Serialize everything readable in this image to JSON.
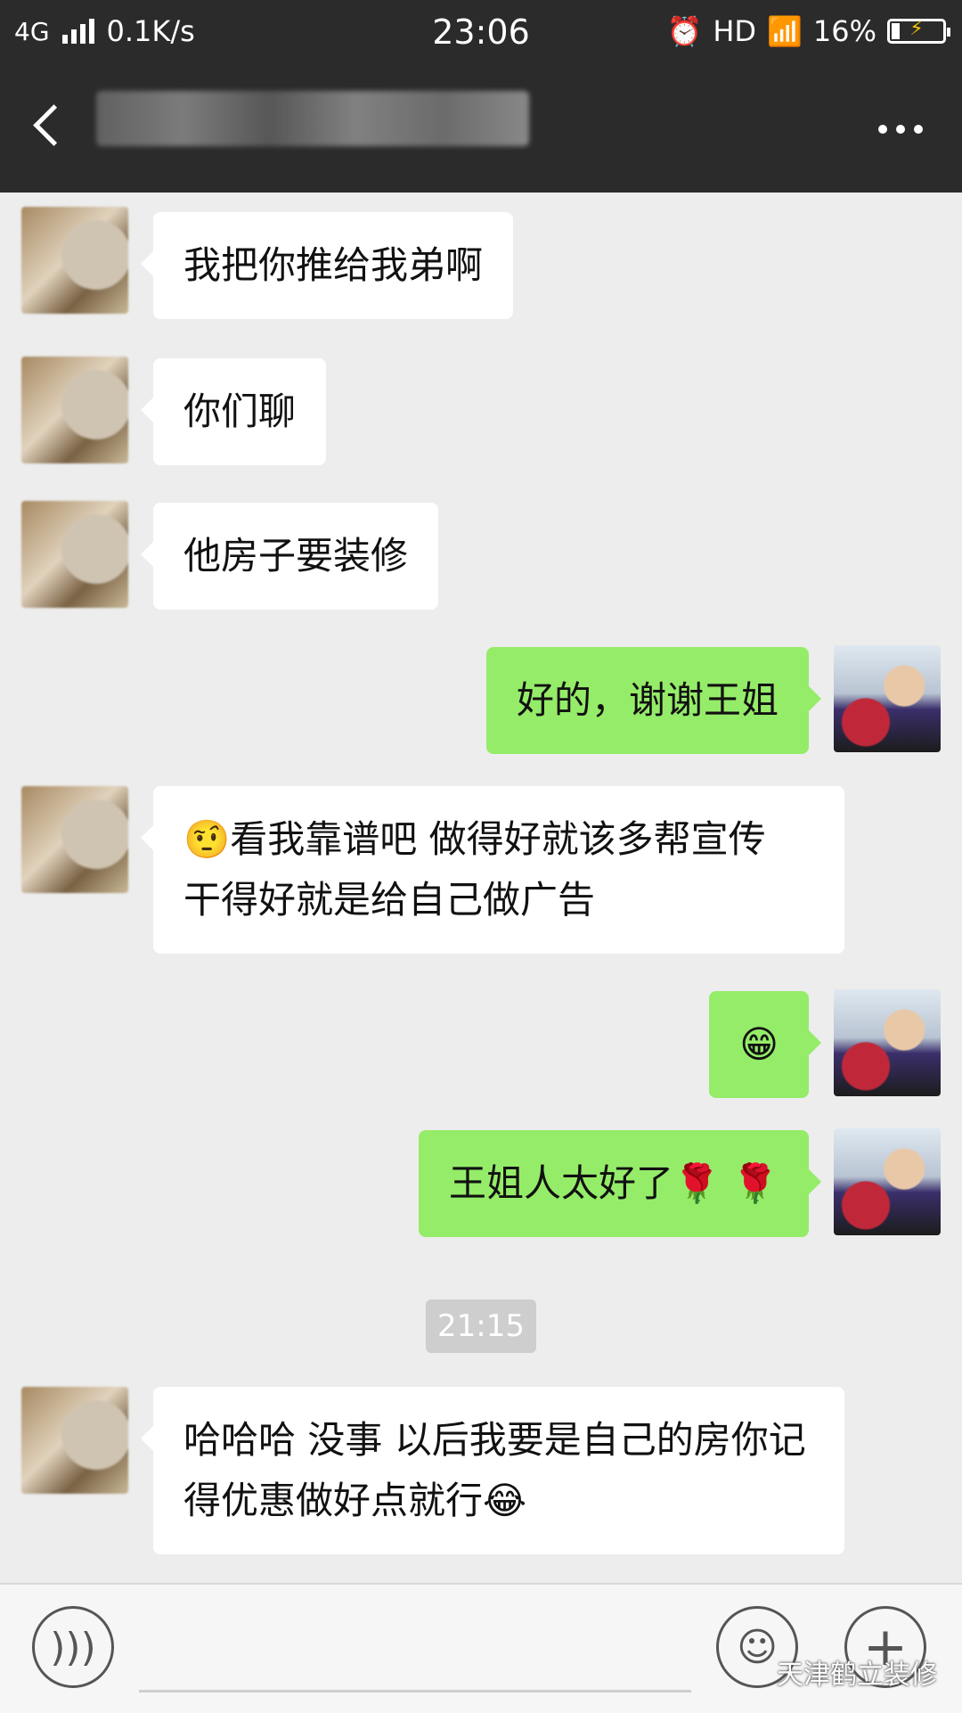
{
  "status_bar": {
    "network": "4G",
    "speed": "0.1K/s",
    "time": "23:06",
    "hd": "HD",
    "battery": "16%",
    "battery_level": 0.16
  },
  "nav": {
    "back_icon": "chevron-left-icon",
    "more_icon": "ellipsis-icon"
  },
  "messages": [
    {
      "side": "in",
      "text": "我把你推给我弟啊"
    },
    {
      "side": "in",
      "text": "你们聊"
    },
    {
      "side": "in",
      "text": "他房子要装修"
    },
    {
      "side": "out",
      "text": "好的，谢谢王姐"
    },
    {
      "side": "in",
      "text": "🤨看我靠谱吧 做得好就该多帮宣传 干得好就是给自己做广告"
    },
    {
      "side": "out",
      "text": "😁"
    },
    {
      "side": "out",
      "text": "王姐人太好了🌹 🌹"
    },
    {
      "side": "in",
      "text": "哈哈哈 没事 以后我要是自己的房你记得优惠做好点就行😂"
    }
  ],
  "timestamp": "21:15",
  "input_bar": {
    "voice_icon": "voice-icon",
    "emoji_icon": "emoji-icon",
    "plus_icon": "plus-icon",
    "watermark": "天津鹤立装修"
  },
  "colors": {
    "outgoing_bubble": "#95ec69",
    "incoming_bubble": "#ffffff",
    "background": "#ededed",
    "header": "#2b2b2b"
  }
}
